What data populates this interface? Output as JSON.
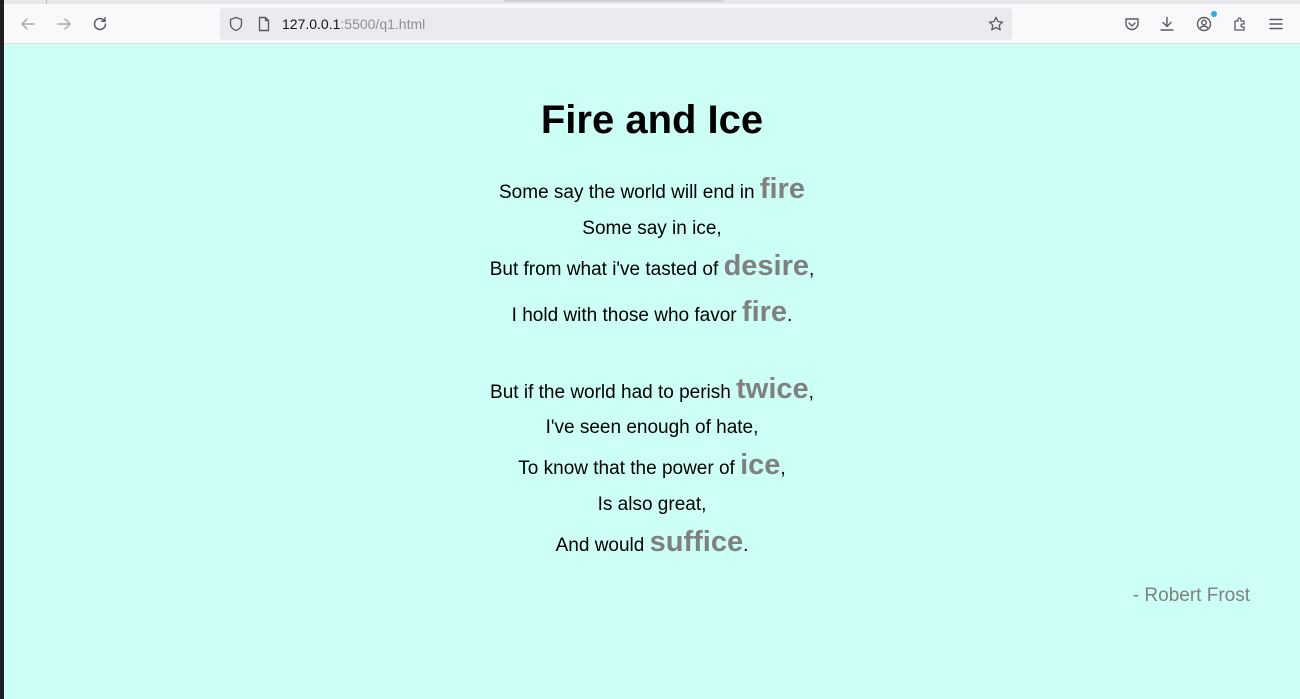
{
  "browser": {
    "url_host": "127.0.0.1",
    "url_rest": ":5500/q1.html",
    "icons": [
      "back-arrow-icon",
      "forward-arrow-icon",
      "reload-icon",
      "shield-icon",
      "page-icon",
      "star-icon",
      "pocket-icon",
      "download-icon",
      "account-icon",
      "extensions-icon",
      "menu-icon"
    ],
    "extension_badge_color": "#1fb3e6"
  },
  "page": {
    "background_color": "#ccfff5",
    "highlight_color": "#808080",
    "title": "Fire and Ice",
    "lines": [
      {
        "pre": "Some say the world will end in ",
        "word": "fire",
        "post": ""
      },
      {
        "pre": "Some say in ice,",
        "word": "",
        "post": ""
      },
      {
        "pre": "But from what i've tasted of ",
        "word": "desire",
        "post": ","
      },
      {
        "pre": "I hold with those who favor ",
        "word": "fire",
        "post": "."
      },
      {
        "pre": "But if the world had to perish ",
        "word": "twice",
        "post": ","
      },
      {
        "pre": "I've seen enough of hate,",
        "word": "",
        "post": ""
      },
      {
        "pre": "To know that the power of ",
        "word": "ice",
        "post": ","
      },
      {
        "pre": "Is also great,",
        "word": "",
        "post": ""
      },
      {
        "pre": "And would ",
        "word": "suffice",
        "post": "."
      }
    ],
    "author": "- Robert Frost"
  }
}
